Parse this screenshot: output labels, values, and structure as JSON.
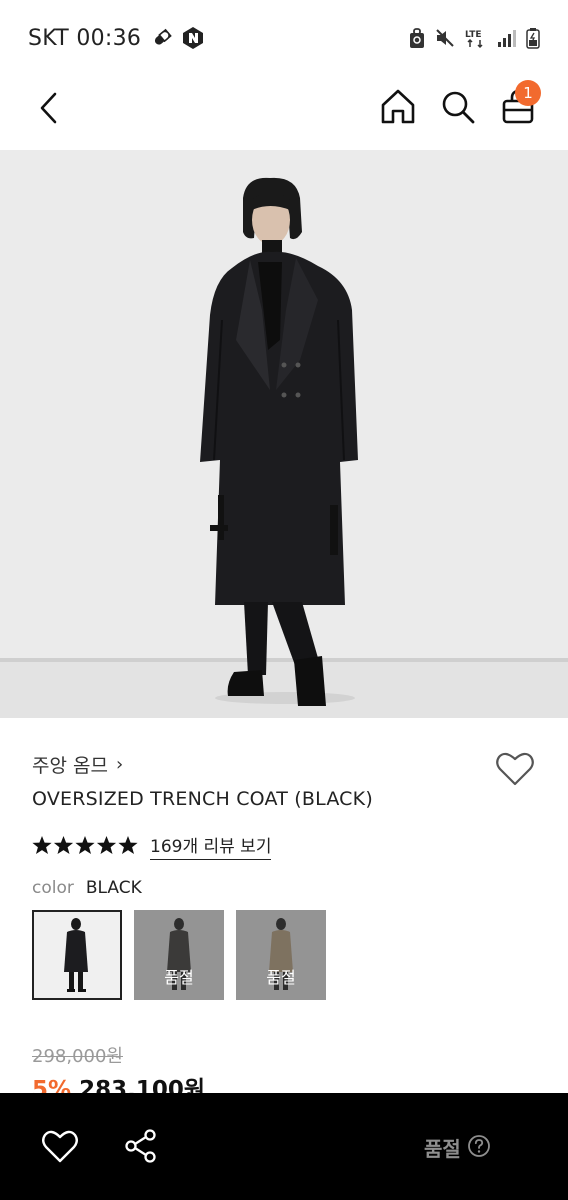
{
  "status_bar": {
    "carrier_time": "SKT 00:36",
    "network": "LTE"
  },
  "nav": {
    "cart_count": "1"
  },
  "product": {
    "brand": "주앙 옴므",
    "brand_chevron": "›",
    "title": "OVERSIZED TRENCH COAT (BLACK)",
    "rating_stars": 5,
    "review_link": "169개 리뷰 보기",
    "color_label": "color",
    "color_value": "BLACK",
    "swatches": [
      {
        "color": "black",
        "selected": true,
        "soldout_label": ""
      },
      {
        "color": "charcoal",
        "selected": false,
        "soldout_label": "품절"
      },
      {
        "color": "beige",
        "selected": false,
        "soldout_label": "품절"
      }
    ],
    "original_price": "298,000원",
    "discount": "5%",
    "sale_price": "283,100원"
  },
  "bottom_bar": {
    "soldout_label": "품절"
  },
  "colors": {
    "accent": "#f26a2e",
    "bottom_bar": "#000000",
    "text": "#1a1a1a"
  }
}
